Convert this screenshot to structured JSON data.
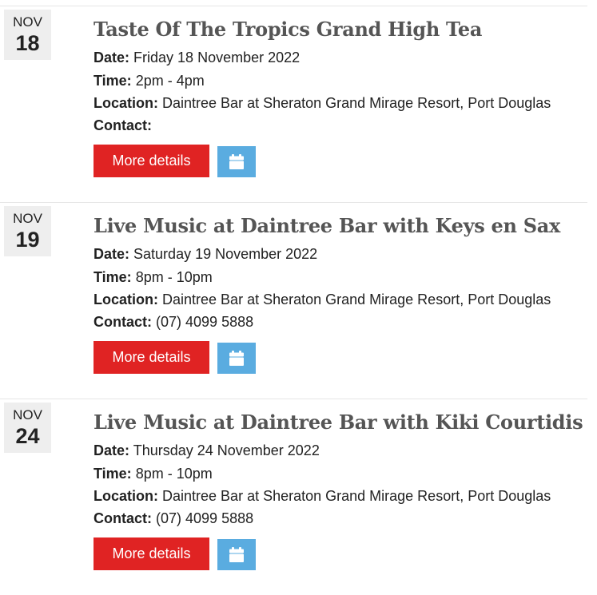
{
  "events": [
    {
      "month": "NOV",
      "day": "18",
      "title": "Taste Of The Tropics Grand High Tea",
      "date_label": "Date:",
      "date_value": "Friday 18 November 2022",
      "time_label": "Time:",
      "time_value": "2pm - 4pm",
      "location_label": "Location:",
      "location_value": "Daintree Bar at Sheraton Grand Mirage Resort, Port Douglas",
      "contact_label": "Contact:",
      "contact_value": "",
      "button_label": "More details",
      "calendar_icon": "calendar-icon"
    },
    {
      "month": "NOV",
      "day": "19",
      "title": "Live Music at Daintree Bar with Keys en Sax",
      "date_label": "Date:",
      "date_value": "Saturday 19 November 2022",
      "time_label": "Time:",
      "time_value": "8pm - 10pm",
      "location_label": "Location:",
      "location_value": "Daintree Bar at Sheraton Grand Mirage Resort, Port Douglas",
      "contact_label": "Contact:",
      "contact_value": "(07) 4099 5888",
      "button_label": "More details",
      "calendar_icon": "calendar-icon"
    },
    {
      "month": "NOV",
      "day": "24",
      "title": "Live Music at Daintree Bar with Kiki Courtidis",
      "date_label": "Date:",
      "date_value": "Thursday 24 November 2022",
      "time_label": "Time:",
      "time_value": "8pm - 10pm",
      "location_label": "Location:",
      "location_value": "Daintree Bar at Sheraton Grand Mirage Resort, Port Douglas",
      "contact_label": "Contact:",
      "contact_value": "(07) 4099 5888",
      "button_label": "More details",
      "calendar_icon": "calendar-icon"
    }
  ],
  "colors": {
    "button_red": "#e02323",
    "calendar_blue": "#5aace0",
    "date_box_gray": "#eeeeee",
    "title_gray": "#555555"
  }
}
